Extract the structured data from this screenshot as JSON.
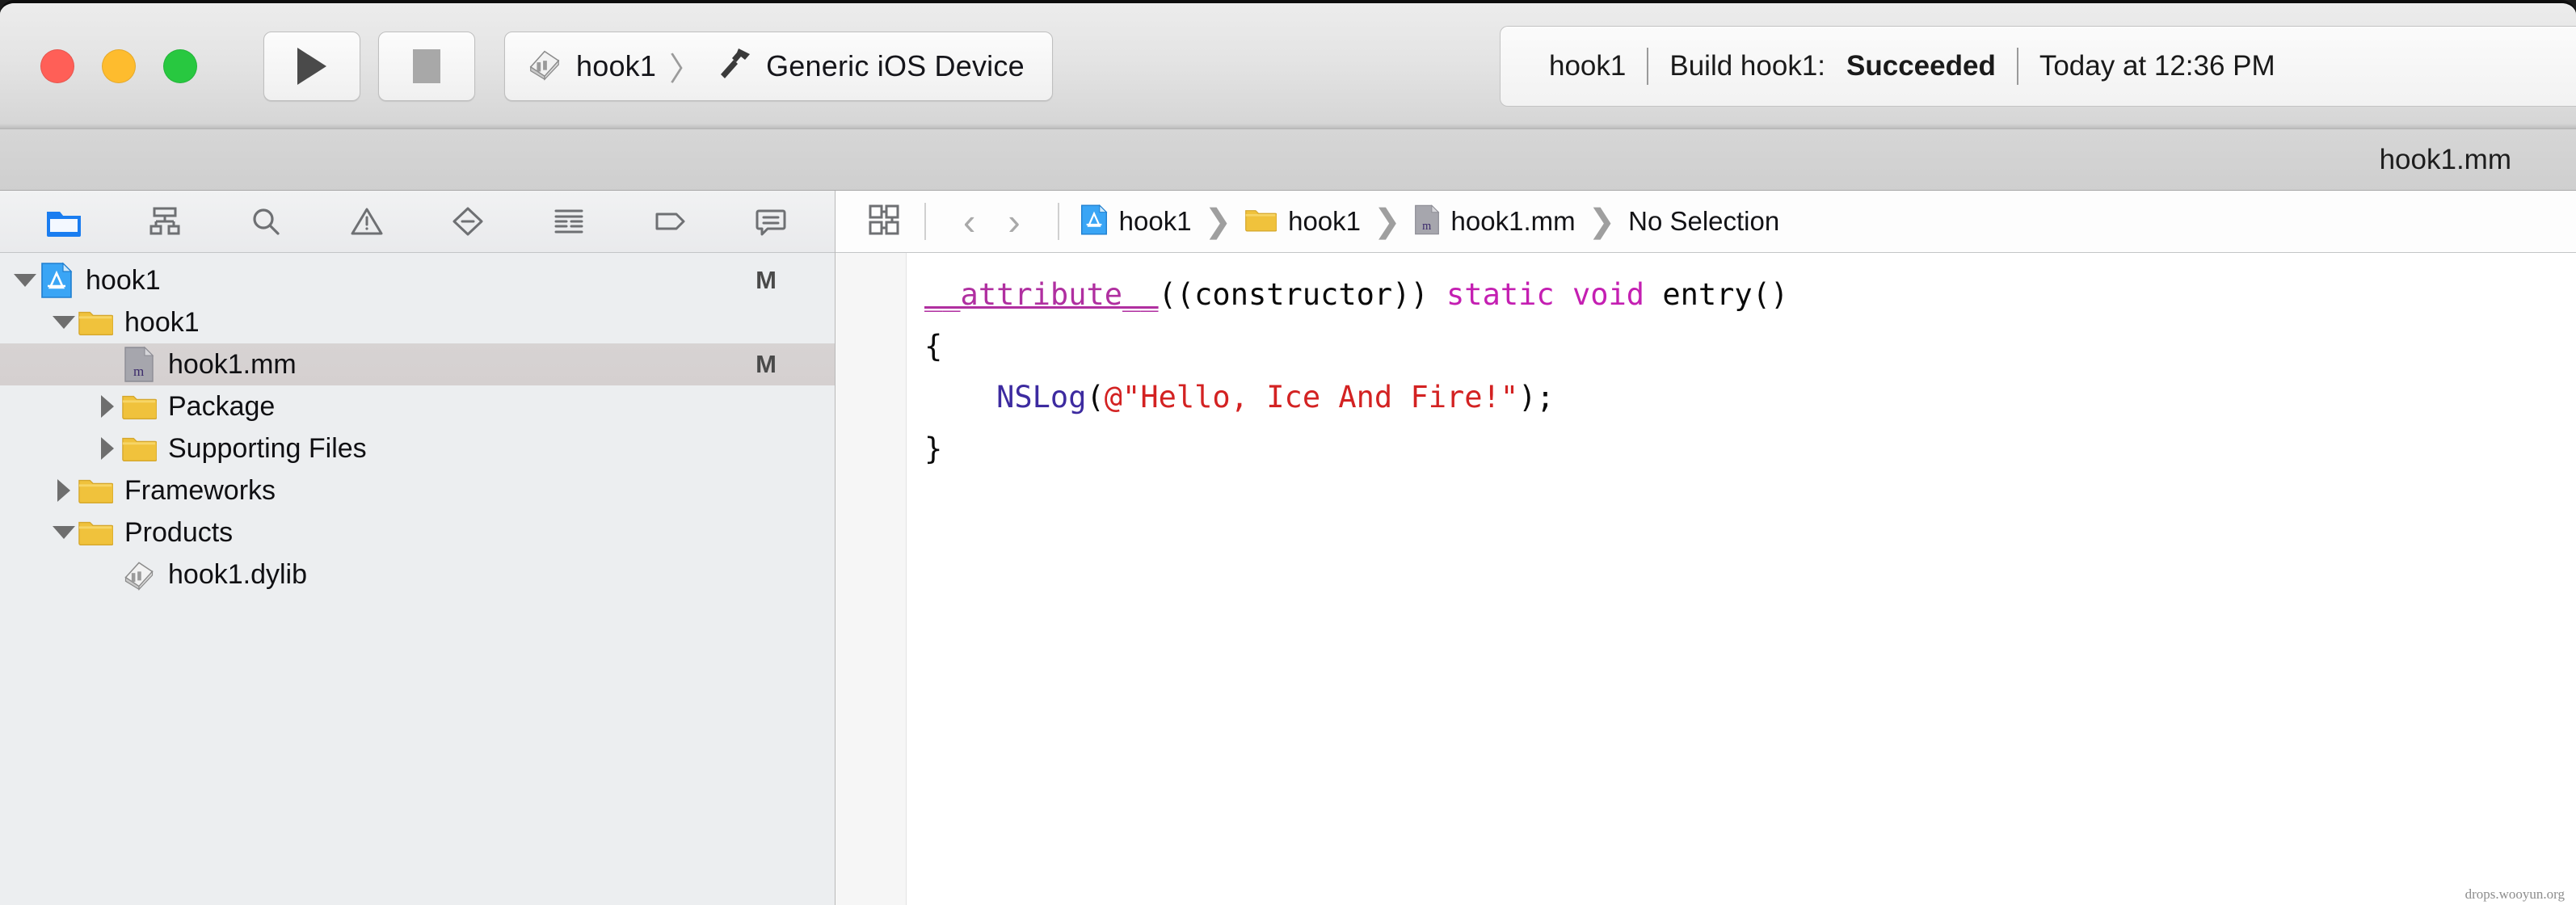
{
  "window": {
    "traffic_lights": [
      {
        "name": "close",
        "color": "#ff5f57"
      },
      {
        "name": "minimize",
        "color": "#febc2e"
      },
      {
        "name": "zoom",
        "color": "#28c840"
      }
    ]
  },
  "toolbar": {
    "run_label": "Run",
    "stop_label": "Stop",
    "scheme": {
      "project": "hook1",
      "separator": "〉",
      "destination": "Generic iOS Device"
    },
    "status": {
      "project": "hook1",
      "build_prefix": "Build hook1:",
      "build_result": "Succeeded",
      "timestamp": "Today at 12:36 PM",
      "divider": "|"
    }
  },
  "document_title": "hook1.mm",
  "navigator": {
    "tabs": [
      {
        "name": "project-navigator",
        "icon": "folder-icon",
        "selected": true
      },
      {
        "name": "source-control-navigator",
        "icon": "hierarchy-icon",
        "selected": false
      },
      {
        "name": "find-navigator",
        "icon": "search-icon",
        "selected": false
      },
      {
        "name": "issue-navigator",
        "icon": "warning-triangle-icon",
        "selected": false
      },
      {
        "name": "test-navigator",
        "icon": "diamond-minus-icon",
        "selected": false
      },
      {
        "name": "debug-navigator",
        "icon": "list-rows-icon",
        "selected": false
      },
      {
        "name": "breakpoint-navigator",
        "icon": "tag-icon",
        "selected": false
      },
      {
        "name": "report-navigator",
        "icon": "speech-bubble-icon",
        "selected": false
      }
    ],
    "tree": [
      {
        "label": "hook1",
        "icon": "xcode-project-icon",
        "indent": 0,
        "twisty": "down",
        "status": "M"
      },
      {
        "label": "hook1",
        "icon": "folder-icon",
        "indent": 1,
        "twisty": "down",
        "status": ""
      },
      {
        "label": "hook1.mm",
        "icon": "objc-file-icon",
        "indent": 2,
        "twisty": "none",
        "status": "M",
        "selected": true
      },
      {
        "label": "Package",
        "icon": "folder-icon",
        "indent": 2,
        "twisty": "right",
        "status": ""
      },
      {
        "label": "Supporting Files",
        "icon": "folder-icon",
        "indent": 2,
        "twisty": "right",
        "status": ""
      },
      {
        "label": "Frameworks",
        "icon": "folder-icon",
        "indent": 1,
        "twisty": "right",
        "status": ""
      },
      {
        "label": "Products",
        "icon": "folder-icon",
        "indent": 1,
        "twisty": "down",
        "status": ""
      },
      {
        "label": "hook1.dylib",
        "icon": "dylib-icon",
        "indent": 2,
        "twisty": "none",
        "status": ""
      }
    ]
  },
  "editor": {
    "jumpbar": {
      "related_items_icon": "related-items-icon",
      "back_label": "‹",
      "forward_label": "›",
      "crumbs": [
        {
          "label": "hook1",
          "icon": "xcode-project-icon"
        },
        {
          "label": "hook1",
          "icon": "folder-icon"
        },
        {
          "label": "hook1.mm",
          "icon": "objc-file-icon"
        },
        {
          "label": "No Selection",
          "icon": ""
        }
      ]
    },
    "code_lines": [
      [
        {
          "t": "__attribute__",
          "c": "attr"
        },
        {
          "t": "((constructor)) ",
          "c": "plain"
        },
        {
          "t": "static void ",
          "c": "kw"
        },
        {
          "t": "entry()",
          "c": "plain"
        }
      ],
      [
        {
          "t": "{",
          "c": "plain"
        }
      ],
      [
        {
          "t": "    ",
          "c": "plain"
        },
        {
          "t": "NSLog",
          "c": "fn"
        },
        {
          "t": "(",
          "c": "plain"
        },
        {
          "t": "@\"Hello, Ice And Fire!\"",
          "c": "str"
        },
        {
          "t": ");",
          "c": "plain"
        }
      ],
      [
        {
          "t": "}",
          "c": "plain"
        }
      ]
    ]
  },
  "watermark": "drops.wooyun.org",
  "colors": {
    "accent_blue": "#1a7df0",
    "folder_yellow": "#f2c23b",
    "string_red": "#d32222",
    "keyword_magenta": "#c41fb2",
    "function_indigo": "#3d2ba0",
    "selection_gray": "#d6d1d1"
  }
}
